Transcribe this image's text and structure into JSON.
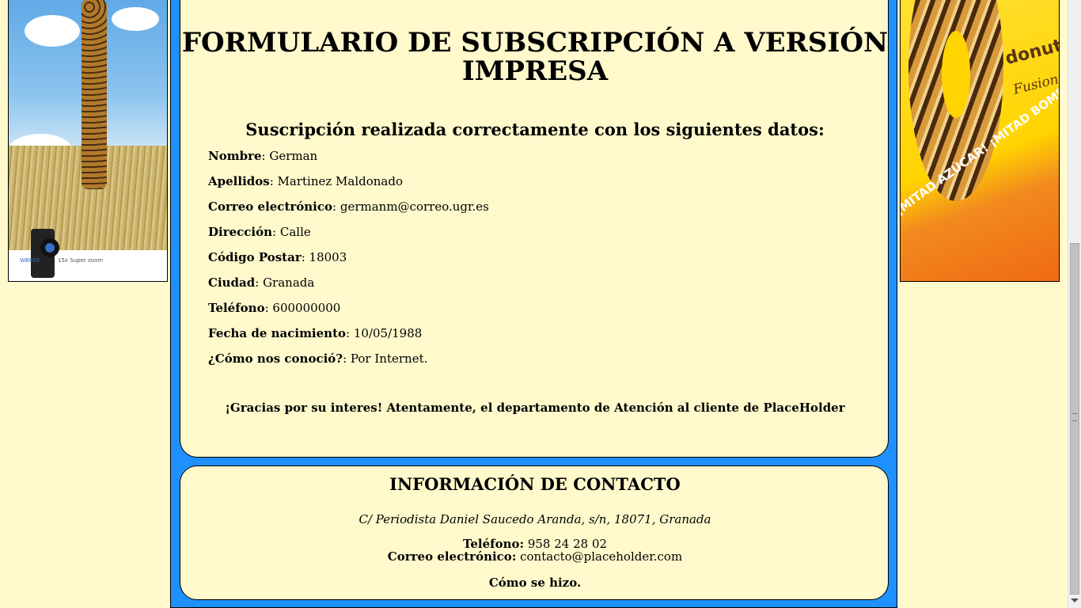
{
  "page": {
    "title": "FORMULARIO DE SUBSCRIPCIÓN A VERSIÓN IMPRESA",
    "success_heading": "Suscripción realizada correctamente con los siguientes datos:",
    "fields": [
      {
        "label": "Nombre",
        "value": ": German"
      },
      {
        "label": "Apellidos",
        "value": ": Martinez Maldonado"
      },
      {
        "label": "Correo electrónico",
        "value": ": germanm@correo.ugr.es"
      },
      {
        "label": "Dirección",
        "value": ": Calle"
      },
      {
        "label": "Código Postar",
        "value": ": 18003"
      },
      {
        "label": "Ciudad",
        "value": ": Granada"
      },
      {
        "label": "Teléfono",
        "value": ": 600000000"
      },
      {
        "label": "Fecha de nacimiento",
        "value": ": 10/05/1988"
      },
      {
        "label": "¿Cómo nos conoció?",
        "value": ": Por Internet."
      }
    ],
    "thanks": "¡Gracias por su interes! Atentamente, el departamento de Atención al cliente de PlaceHolder"
  },
  "contact": {
    "title": "INFORMACIÓN DE CONTACTO",
    "address": "C/ Periodista Daniel Saucedo Aranda, s/n, 18071, Granada",
    "phone_label": "Teléfono:",
    "phone_value": " 958 24 28 02",
    "email_label": "Correo electrónico:",
    "email_value": " contacto@placeholder.com",
    "how_link": "Cómo se hizo."
  },
  "ads": {
    "left": {
      "model": "WB650",
      "caption": "15x Super zoom"
    },
    "right": {
      "brand": "donuts",
      "subbrand": "Fusion",
      "slogan": "¡MITAD AZÚCAR! ¡MITAD BOMBÓN!"
    }
  },
  "colors": {
    "background": "#fff9cc",
    "frame": "#1e90ff"
  }
}
